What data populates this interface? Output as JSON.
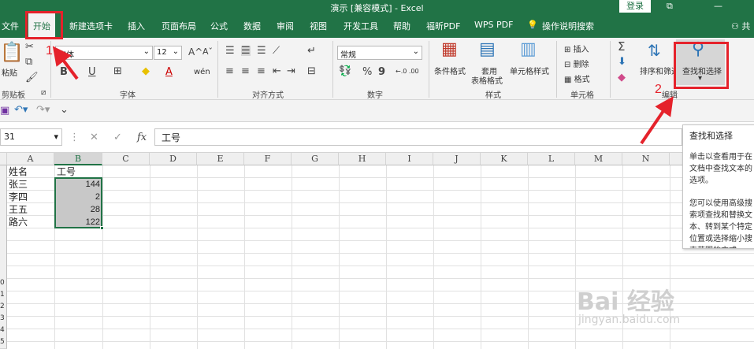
{
  "window": {
    "title": "演示 [兼容模式] - Excel",
    "login_label": "登录",
    "restore_icon": "restore-icon",
    "min_icon": "minimize-icon"
  },
  "tabs": [
    {
      "label": "文件"
    },
    {
      "label": "开始"
    },
    {
      "label": "新建选项卡"
    },
    {
      "label": "插入"
    },
    {
      "label": "页面布局"
    },
    {
      "label": "公式"
    },
    {
      "label": "数据"
    },
    {
      "label": "审阅"
    },
    {
      "label": "视图"
    },
    {
      "label": "开发工具"
    },
    {
      "label": "帮助"
    },
    {
      "label": "福昕PDF"
    },
    {
      "label": "WPS PDF"
    },
    {
      "label": "操作说明搜索"
    },
    {
      "label": "共"
    }
  ],
  "ribbon": {
    "clipboard": {
      "paste_label": "粘贴",
      "group_label": "剪贴板"
    },
    "font": {
      "font_name": "宋体",
      "font_size": "12",
      "grow_label": "A",
      "shrink_label": "A",
      "bold": "B",
      "underline": "U",
      "color_letter": "A",
      "wen_label": "wén",
      "group_label": "字体"
    },
    "alignment": {
      "group_label": "对齐方式"
    },
    "number": {
      "format_value": "常规",
      "percent": "%",
      "comma": "9",
      "dec_inc": "←.0 .00",
      "dec_dec": ".00 →.0",
      "group_label": "数字"
    },
    "styles": {
      "conditional_label": "条件格式",
      "table_label_1": "套用",
      "table_label_2": "表格格式",
      "cell_style_label": "单元格样式",
      "group_label": "样式"
    },
    "cells": {
      "insert_label": "插入",
      "delete_label": "删除",
      "format_label": "格式",
      "group_label": "单元格"
    },
    "editing": {
      "sigma": "Σ",
      "sort_label": "排序和筛选",
      "find_label": "查找和选择",
      "group_label": "编辑"
    }
  },
  "formula_bar": {
    "namebox": "31",
    "fx_label": "fx",
    "content": "工号"
  },
  "columns": [
    "A",
    "B",
    "C",
    "D",
    "E",
    "F",
    "G",
    "H",
    "I",
    "J",
    "K",
    "L",
    "M",
    "N"
  ],
  "cells": {
    "a1": "姓名",
    "b1": "工号",
    "a2": "张三",
    "b2": "144",
    "a3": "李四",
    "b3": "2",
    "a4": "王五",
    "b4": "28",
    "a5": "路六",
    "b5": "122"
  },
  "row_numbers": [
    "0",
    "1",
    "2",
    "3",
    "4",
    "5"
  ],
  "tooltip": {
    "title": "查找和选择",
    "p1": "单击以查看用于在文档中查找文本的选项。",
    "p2": "您可以使用高级搜索项查找和替换文本、转到某个特定位置或选择缩小搜索范围的方式。"
  },
  "annotations": {
    "step1": "1",
    "step2": "2"
  },
  "watermark": {
    "main": "Bai 经验",
    "sub": "jingyan.baidu.com"
  },
  "colors": {
    "excel_green": "#217346",
    "annotation_red": "#e5222b",
    "selection_gray": "#c8c8c8"
  }
}
